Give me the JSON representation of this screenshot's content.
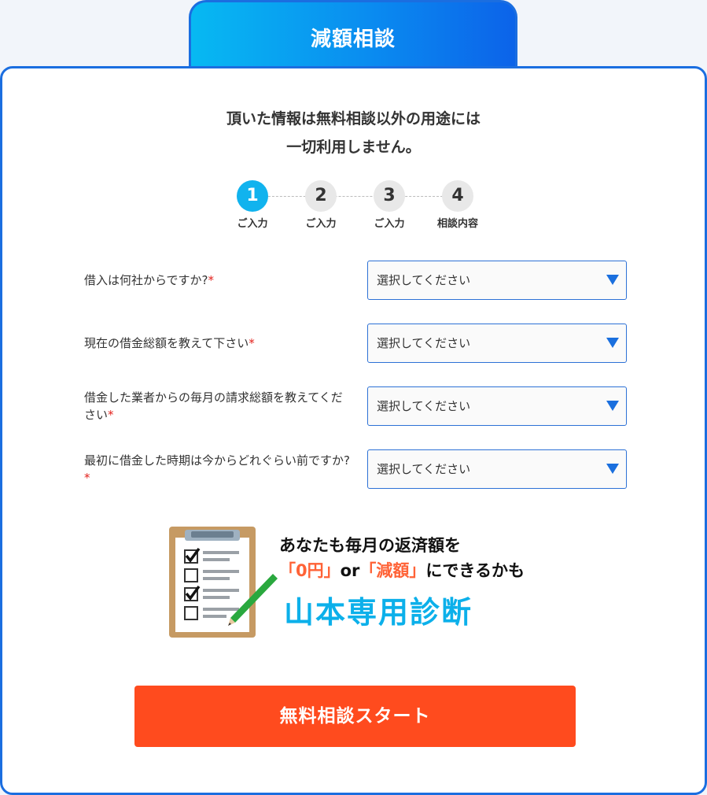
{
  "tab": {
    "label": "減額相談"
  },
  "lead": {
    "line1": "頂いた情報は無料相談以外の用途には",
    "line2": "一切利用しません。"
  },
  "steps": [
    {
      "num": "1",
      "label": "ご入力"
    },
    {
      "num": "2",
      "label": "ご入力"
    },
    {
      "num": "3",
      "label": "ご入力"
    },
    {
      "num": "4",
      "label": "相談内容"
    }
  ],
  "form": {
    "required_mark": "*",
    "fields": [
      {
        "question": "借入は何社からですか?",
        "value": "選択してください"
      },
      {
        "question": "現在の借金総額を教えて下さい",
        "value": "選択してください"
      },
      {
        "question": "借金した業者からの毎月の請求総額を教えてください",
        "value": "選択してください"
      },
      {
        "question": "最初に借金した時期は今からどれぐらい前ですか?",
        "value": "選択してください"
      }
    ]
  },
  "promo": {
    "line1": "あなたも毎月の返済額を",
    "hl1": "「0円」",
    "or": "or",
    "hl2": "「減額」",
    "line2_tail": "にできるかも",
    "title": "山本専用診断"
  },
  "cta": {
    "label": "無料相談スタート"
  },
  "colors": {
    "primary": "#1b6ee0",
    "active_step": "#11b3ee",
    "cta": "#ff4b1e",
    "highlight": "#ff6236",
    "promo_title": "#0cb0ea",
    "required": "#e3201b"
  },
  "icons": {
    "select": "triangle-down-icon",
    "promo": "clipboard-checklist-icon"
  }
}
